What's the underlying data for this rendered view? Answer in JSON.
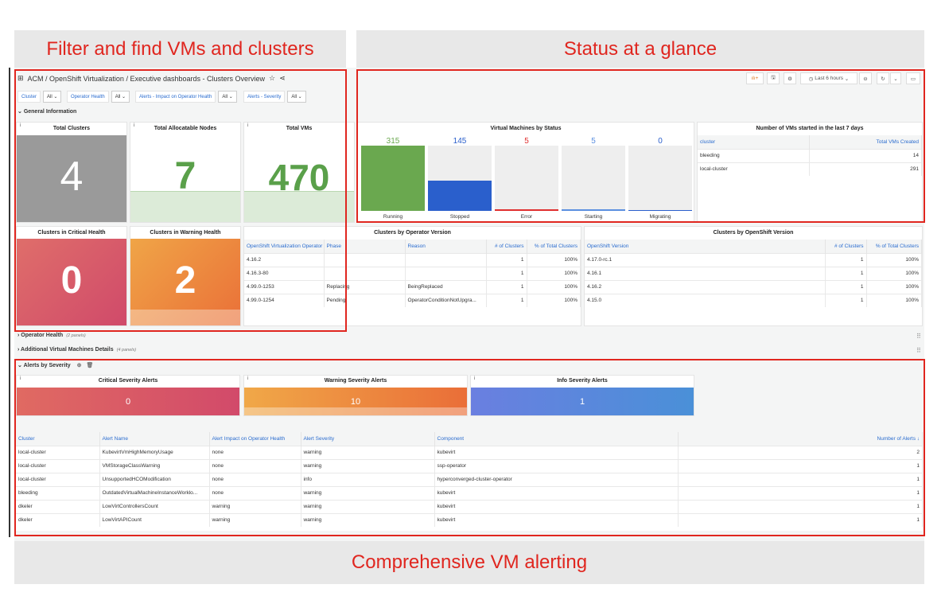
{
  "annotations": {
    "filter": "Filter and find VMs and clusters",
    "status": "Status at a glance",
    "alerting": "Comprehensive VM alerting"
  },
  "header": {
    "breadcrumb": "ACM / OpenShift Virtualization  / Executive dashboards - Clusters Overview",
    "time_range": "Last 6 hours"
  },
  "filters": [
    {
      "label": "Cluster",
      "value": "All"
    },
    {
      "label": "Operator Health",
      "value": "All"
    },
    {
      "label": "Alerts - Impact on Operator Health",
      "value": "All"
    },
    {
      "label": "Alerts - Severity",
      "value": "All"
    }
  ],
  "sections": {
    "general": "General Information",
    "operator_health": "Operator Health",
    "operator_health_count": "(2 panels)",
    "additional": "Additional Virtual Machines Details",
    "additional_count": "(4 panels)",
    "alerts": "Alerts by Severity"
  },
  "stats": {
    "total_clusters": {
      "title": "Total Clusters",
      "value": "4"
    },
    "nodes": {
      "title": "Total Allocatable Nodes",
      "value": "7"
    },
    "vms": {
      "title": "Total VMs",
      "value": "470"
    },
    "critical": {
      "title": "Clusters in Critical Health",
      "value": "0"
    },
    "warning": {
      "title": "Clusters in Warning Health",
      "value": "2"
    }
  },
  "vm_status": {
    "title": "Virtual Machines by Status",
    "items": [
      {
        "label": "Running",
        "value": "315",
        "color": "#6aa84f",
        "fill": 1.0
      },
      {
        "label": "Stopped",
        "value": "145",
        "color": "#2a5fcc",
        "fill": 0.46
      },
      {
        "label": "Error",
        "value": "5",
        "color": "#e02f2f",
        "fill": 0.02
      },
      {
        "label": "Starting",
        "value": "5",
        "color": "#5b8fe0",
        "fill": 0.02
      },
      {
        "label": "Migrating",
        "value": "0",
        "color": "#2a5fcc",
        "fill": 0.01
      }
    ]
  },
  "vms_started": {
    "title": "Number of VMs started in the last 7 days",
    "headers": [
      "cluster",
      "Total VMs Created"
    ],
    "rows": [
      [
        "bleeding",
        "14"
      ],
      [
        "local-cluster",
        "291"
      ]
    ]
  },
  "operator_version": {
    "title": "Clusters by Operator Version",
    "headers": [
      "OpenShift Virtualization Operator",
      "Phase",
      "Reason",
      "# of Clusters",
      "% of Total Clusters"
    ],
    "rows": [
      [
        "4.16.2",
        "",
        "",
        "1",
        "100%"
      ],
      [
        "4.16.3-80",
        "",
        "",
        "1",
        "100%"
      ],
      [
        "4.99.0-1253",
        "Replacing",
        "BeingReplaced",
        "1",
        "100%"
      ],
      [
        "4.99.0-1254",
        "Pending",
        "OperatorConditionNotUpgra...",
        "1",
        "100%"
      ]
    ]
  },
  "openshift_version": {
    "title": "Clusters by OpenShift Version",
    "headers": [
      "OpenShift Version",
      "# of Clusters",
      "% of Total Clusters"
    ],
    "rows": [
      [
        "4.17.0-rc.1",
        "1",
        "100%"
      ],
      [
        "4.16.1",
        "1",
        "100%"
      ],
      [
        "4.16.2",
        "1",
        "100%"
      ],
      [
        "4.15.0",
        "1",
        "100%"
      ]
    ]
  },
  "alert_stats": {
    "critical": {
      "title": "Critical Severity Alerts",
      "value": "0"
    },
    "warning": {
      "title": "Warning Severity Alerts",
      "value": "10"
    },
    "info": {
      "title": "Info Severity Alerts",
      "value": "1"
    }
  },
  "alerts_table": {
    "headers": [
      "Cluster",
      "Alert Name",
      "Alert Impact on Operator Health",
      "Alert Severity",
      "Component",
      "Number of Alerts ↓"
    ],
    "rows": [
      [
        "local-cluster",
        "KubevirtVmHighMemoryUsage",
        "none",
        "warning",
        "kubevirt",
        "2"
      ],
      [
        "local-cluster",
        "VMStorageClassWarning",
        "none",
        "warning",
        "ssp-operator",
        "1"
      ],
      [
        "local-cluster",
        "UnsupportedHCOModification",
        "none",
        "info",
        "hyperconverged-cluster-operator",
        "1"
      ],
      [
        "bleeding",
        "OutdatedVirtualMachineInstanceWorklo...",
        "none",
        "warning",
        "kubevirt",
        "1"
      ],
      [
        "dkeler",
        "LowVirtControllersCount",
        "warning",
        "warning",
        "kubevirt",
        "1"
      ],
      [
        "dkeler",
        "LowVirtAPICount",
        "warning",
        "warning",
        "kubevirt",
        "1"
      ]
    ]
  }
}
